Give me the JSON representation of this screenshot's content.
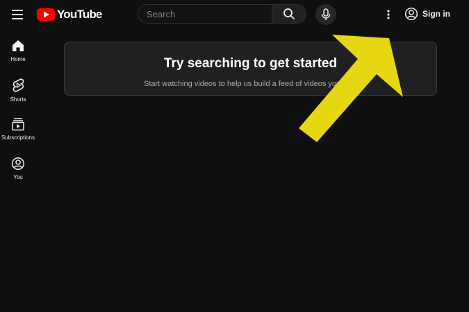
{
  "header": {
    "logo_text": "YouTube",
    "search_placeholder": "Search",
    "signin_label": "Sign in"
  },
  "sidebar": {
    "items": [
      {
        "label": "Home",
        "icon": "home-icon"
      },
      {
        "label": "Shorts",
        "icon": "shorts-icon"
      },
      {
        "label": "Subscriptions",
        "icon": "subscriptions-icon"
      },
      {
        "label": "You",
        "icon": "you-icon"
      }
    ]
  },
  "main": {
    "prompt_title": "Try searching to get started",
    "prompt_subtitle": "Start watching videos to help us build a feed of videos you'll love."
  },
  "colors": {
    "background": "#0f0f0f",
    "brand_red": "#ff0000",
    "annotation_arrow": "#e6d712",
    "card_bg": "#202020"
  }
}
